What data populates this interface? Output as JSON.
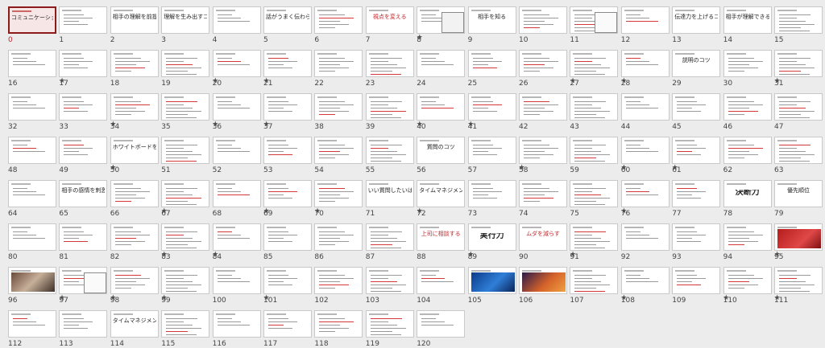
{
  "view": {
    "name": "slide-sorter",
    "selected_slide": "0"
  },
  "colors": {
    "accent": "#c0282d",
    "selected_border": "#8e1b1b",
    "background": "#ececec"
  },
  "star_glyph": "★",
  "slides": [
    {
      "num": "0",
      "title": "コミュニケーションをタイムマネジメント",
      "selected": true,
      "star": false,
      "style": "text"
    },
    {
      "num": "1",
      "title": "",
      "star": false,
      "style": "lines"
    },
    {
      "num": "2",
      "title": "相手の理解を前提にするコミュニケーションスキル",
      "star": false,
      "style": "text"
    },
    {
      "num": "3",
      "title": "理解を生み出すコツ",
      "star": false,
      "style": "text"
    },
    {
      "num": "4",
      "title": "",
      "star": false,
      "style": "lines"
    },
    {
      "num": "5",
      "title": "話がうまく伝わらないときは",
      "star": false,
      "style": "text"
    },
    {
      "num": "6",
      "title": "",
      "star": false,
      "style": "lines"
    },
    {
      "num": "7",
      "title": "視点を変える",
      "star": true,
      "style": "text",
      "hl": true
    },
    {
      "num": "8",
      "title": "",
      "star": false,
      "style": "chart"
    },
    {
      "num": "9",
      "title": "相手を知る",
      "star": false,
      "style": "text"
    },
    {
      "num": "10",
      "title": "",
      "star": false,
      "style": "lines"
    },
    {
      "num": "11",
      "title": "",
      "star": false,
      "style": "diagram"
    },
    {
      "num": "12",
      "title": "",
      "star": false,
      "style": "lines"
    },
    {
      "num": "13",
      "title": "伝達力を上げるコツ",
      "star": false,
      "style": "text"
    },
    {
      "num": "14",
      "title": "相手が理解できるコミュニケーション",
      "star": false,
      "style": "text"
    },
    {
      "num": "15",
      "title": "",
      "star": true,
      "style": "lines"
    },
    {
      "num": "16",
      "title": "",
      "star": true,
      "style": "lines"
    },
    {
      "num": "17",
      "title": "",
      "star": false,
      "style": "lines"
    },
    {
      "num": "18",
      "title": "",
      "star": false,
      "style": "lines"
    },
    {
      "num": "19",
      "title": "",
      "star": true,
      "style": "lines"
    },
    {
      "num": "20",
      "title": "",
      "star": true,
      "style": "lines"
    },
    {
      "num": "21",
      "title": "",
      "star": false,
      "style": "lines"
    },
    {
      "num": "22",
      "title": "",
      "star": false,
      "style": "lines"
    },
    {
      "num": "23",
      "title": "",
      "star": false,
      "style": "lines"
    },
    {
      "num": "24",
      "title": "",
      "star": false,
      "style": "lines"
    },
    {
      "num": "25",
      "title": "",
      "star": false,
      "style": "lines"
    },
    {
      "num": "26",
      "title": "",
      "star": true,
      "style": "lines"
    },
    {
      "num": "27",
      "title": "",
      "star": true,
      "style": "lines"
    },
    {
      "num": "28",
      "title": "",
      "star": false,
      "style": "lines"
    },
    {
      "num": "29",
      "title": "説明のコツ",
      "star": false,
      "style": "text"
    },
    {
      "num": "30",
      "title": "",
      "star": true,
      "style": "lines"
    },
    {
      "num": "31",
      "title": "",
      "star": false,
      "style": "lines"
    },
    {
      "num": "32",
      "title": "",
      "star": false,
      "style": "lines"
    },
    {
      "num": "33",
      "title": "",
      "star": true,
      "style": "lines"
    },
    {
      "num": "34",
      "title": "",
      "star": false,
      "style": "lines"
    },
    {
      "num": "35",
      "title": "",
      "star": true,
      "style": "lines"
    },
    {
      "num": "36",
      "title": "",
      "star": true,
      "style": "lines"
    },
    {
      "num": "37",
      "title": "",
      "star": false,
      "style": "lines"
    },
    {
      "num": "38",
      "title": "",
      "star": false,
      "style": "lines"
    },
    {
      "num": "39",
      "title": "",
      "star": true,
      "style": "lines"
    },
    {
      "num": "40",
      "title": "",
      "star": true,
      "style": "lines"
    },
    {
      "num": "41",
      "title": "",
      "star": false,
      "style": "lines"
    },
    {
      "num": "42",
      "title": "",
      "star": false,
      "style": "lines"
    },
    {
      "num": "43",
      "title": "",
      "star": false,
      "style": "lines"
    },
    {
      "num": "44",
      "title": "",
      "star": false,
      "style": "lines"
    },
    {
      "num": "45",
      "title": "",
      "star": false,
      "style": "lines"
    },
    {
      "num": "46",
      "title": "",
      "star": false,
      "style": "lines"
    },
    {
      "num": "47",
      "title": "",
      "star": false,
      "style": "lines"
    },
    {
      "num": "48",
      "title": "",
      "star": false,
      "style": "lines"
    },
    {
      "num": "49",
      "title": "",
      "star": true,
      "style": "lines"
    },
    {
      "num": "50",
      "title": "ホワイトボードを活用する",
      "star": false,
      "style": "text"
    },
    {
      "num": "51",
      "title": "",
      "star": false,
      "style": "lines"
    },
    {
      "num": "52",
      "title": "",
      "star": false,
      "style": "lines"
    },
    {
      "num": "53",
      "title": "",
      "star": false,
      "style": "lines"
    },
    {
      "num": "54",
      "title": "",
      "star": false,
      "style": "lines"
    },
    {
      "num": "55",
      "title": "",
      "star": false,
      "style": "lines"
    },
    {
      "num": "56",
      "title": "質問のコツ",
      "star": false,
      "style": "text"
    },
    {
      "num": "57",
      "title": "",
      "star": true,
      "style": "lines"
    },
    {
      "num": "58",
      "title": "",
      "star": false,
      "style": "lines"
    },
    {
      "num": "59",
      "title": "",
      "star": true,
      "style": "lines"
    },
    {
      "num": "60",
      "title": "",
      "star": true,
      "style": "lines"
    },
    {
      "num": "61",
      "title": "",
      "star": false,
      "style": "lines"
    },
    {
      "num": "62",
      "title": "",
      "star": false,
      "style": "lines"
    },
    {
      "num": "63",
      "title": "",
      "star": false,
      "style": "lines"
    },
    {
      "num": "64",
      "title": "",
      "star": false,
      "style": "lines"
    },
    {
      "num": "65",
      "title": "相手の感情を刺激する",
      "star": false,
      "style": "text"
    },
    {
      "num": "66",
      "title": "",
      "star": true,
      "style": "lines"
    },
    {
      "num": "67",
      "title": "",
      "star": false,
      "style": "lines"
    },
    {
      "num": "68",
      "title": "",
      "star": true,
      "style": "lines"
    },
    {
      "num": "69",
      "title": "",
      "star": true,
      "style": "lines"
    },
    {
      "num": "70",
      "title": "",
      "star": false,
      "style": "lines"
    },
    {
      "num": "71",
      "title": "いい質問したいは",
      "star": true,
      "style": "text"
    },
    {
      "num": "72",
      "title": "タイムマネジメント",
      "star": false,
      "style": "text"
    },
    {
      "num": "73",
      "title": "",
      "star": false,
      "style": "lines"
    },
    {
      "num": "74",
      "title": "",
      "star": false,
      "style": "lines"
    },
    {
      "num": "75",
      "title": "",
      "star": true,
      "style": "lines"
    },
    {
      "num": "76",
      "title": "",
      "star": false,
      "style": "lines"
    },
    {
      "num": "77",
      "title": "",
      "star": false,
      "style": "lines"
    },
    {
      "num": "78",
      "title": "決断力",
      "star": false,
      "style": "text",
      "big": true
    },
    {
      "num": "79",
      "title": "優先順位",
      "star": true,
      "style": "text"
    },
    {
      "num": "80",
      "title": "",
      "star": false,
      "style": "lines"
    },
    {
      "num": "81",
      "title": "",
      "star": false,
      "style": "lines"
    },
    {
      "num": "82",
      "title": "",
      "star": true,
      "style": "lines"
    },
    {
      "num": "83",
      "title": "",
      "star": true,
      "style": "lines"
    },
    {
      "num": "84",
      "title": "",
      "star": false,
      "style": "lines"
    },
    {
      "num": "85",
      "title": "",
      "star": false,
      "style": "lines"
    },
    {
      "num": "86",
      "title": "",
      "star": false,
      "style": "lines"
    },
    {
      "num": "87",
      "title": "",
      "star": false,
      "style": "lines"
    },
    {
      "num": "88",
      "title": "上司に相談する",
      "star": true,
      "style": "text",
      "hl": true
    },
    {
      "num": "89",
      "title": "実行力",
      "star": false,
      "style": "text",
      "big": true
    },
    {
      "num": "90",
      "title": "ムダを減らす",
      "star": true,
      "style": "text",
      "hl": true
    },
    {
      "num": "91",
      "title": "",
      "star": false,
      "style": "lines"
    },
    {
      "num": "92",
      "title": "",
      "star": false,
      "style": "lines"
    },
    {
      "num": "93",
      "title": "",
      "star": false,
      "style": "lines"
    },
    {
      "num": "94",
      "title": "",
      "star": true,
      "style": "lines"
    },
    {
      "num": "95",
      "title": "",
      "star": false,
      "style": "redphoto"
    },
    {
      "num": "96",
      "title": "",
      "star": true,
      "style": "photo"
    },
    {
      "num": "97",
      "title": "",
      "star": true,
      "style": "diagram"
    },
    {
      "num": "98",
      "title": "",
      "star": true,
      "style": "lines"
    },
    {
      "num": "99",
      "title": "",
      "star": false,
      "style": "lines"
    },
    {
      "num": "100",
      "title": "",
      "star": true,
      "style": "lines"
    },
    {
      "num": "101",
      "title": "",
      "star": false,
      "style": "lines"
    },
    {
      "num": "102",
      "title": "",
      "star": false,
      "style": "lines"
    },
    {
      "num": "103",
      "title": "",
      "star": false,
      "style": "lines"
    },
    {
      "num": "104",
      "title": "",
      "star": false,
      "style": "lines"
    },
    {
      "num": "105",
      "title": "",
      "star": false,
      "style": "bluephoto"
    },
    {
      "num": "106",
      "title": "",
      "star": false,
      "style": "orangephoto"
    },
    {
      "num": "107",
      "title": "",
      "star": true,
      "style": "lines"
    },
    {
      "num": "108",
      "title": "",
      "star": false,
      "style": "lines"
    },
    {
      "num": "109",
      "title": "",
      "star": true,
      "style": "lines"
    },
    {
      "num": "110",
      "title": "",
      "star": true,
      "style": "lines"
    },
    {
      "num": "111",
      "title": "",
      "star": false,
      "style": "lines"
    },
    {
      "num": "112",
      "title": "",
      "star": false,
      "style": "lines"
    },
    {
      "num": "113",
      "title": "",
      "star": false,
      "style": "lines"
    },
    {
      "num": "114",
      "title": "タイムマネジメント",
      "star": false,
      "style": "text"
    },
    {
      "num": "115",
      "title": "",
      "star": false,
      "style": "lines"
    },
    {
      "num": "116",
      "title": "",
      "star": false,
      "style": "lines"
    },
    {
      "num": "117",
      "title": "",
      "star": false,
      "style": "lines"
    },
    {
      "num": "118",
      "title": "",
      "star": false,
      "style": "lines"
    },
    {
      "num": "119",
      "title": "",
      "star": false,
      "style": "lines"
    },
    {
      "num": "120",
      "title": "",
      "star": false,
      "style": "lines"
    }
  ]
}
